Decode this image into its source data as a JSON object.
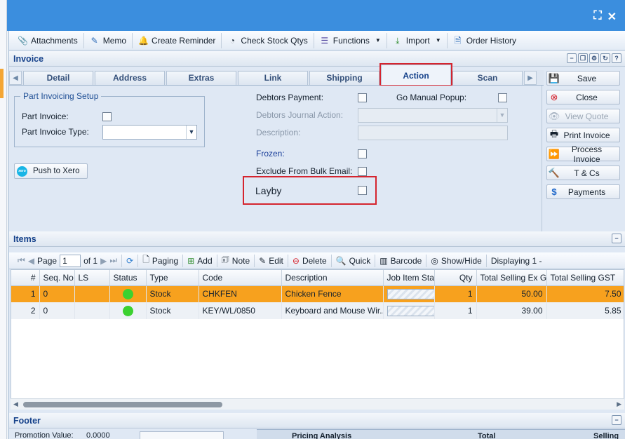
{
  "toolbar": {
    "attachments": "Attachments",
    "memo": "Memo",
    "create_reminder": "Create Reminder",
    "check_stock": "Check Stock Qtys",
    "functions": "Functions",
    "import": "Import",
    "order_history": "Order History"
  },
  "invoice_panel": {
    "title": "Invoice"
  },
  "tabs": [
    "Detail",
    "Address",
    "Extras",
    "Link",
    "Shipping",
    "Action",
    "Scan"
  ],
  "active_tab": "Action",
  "form": {
    "part_invoicing_legend": "Part Invoicing Setup",
    "part_invoice_label": "Part Invoice:",
    "part_invoice_type_label": "Part Invoice Type:",
    "part_invoice_type_value": "",
    "push_to_xero": "Push to Xero",
    "xero_logo": "xero",
    "debtors_payment_label": "Debtors Payment:",
    "go_manual_popup_label": "Go Manual Popup:",
    "debtors_journal_action_label": "Debtors Journal Action:",
    "description_label": "Description:",
    "frozen_label": "Frozen:",
    "exclude_bulk_email_label": "Exclude From Bulk Email:",
    "layby_label": "Layby"
  },
  "side_buttons": {
    "save": "Save",
    "close": "Close",
    "view_quote": "View Quote",
    "print_invoice": "Print Invoice",
    "process_invoice": "Process Invoice",
    "tcs": "T & Cs",
    "payments": "Payments"
  },
  "items_panel": {
    "title": "Items"
  },
  "grid_toolbar": {
    "page_label": "Page",
    "page_value": "1",
    "of_label": "of 1",
    "paging": "Paging",
    "add": "Add",
    "note": "Note",
    "edit": "Edit",
    "delete": "Delete",
    "quick": "Quick",
    "barcode": "Barcode",
    "show_hide": "Show/Hide",
    "displaying": "Displaying 1 -"
  },
  "grid": {
    "columns": [
      "#",
      "Seq. No.",
      "LS",
      "Status",
      "Type",
      "Code",
      "Description",
      "Job Item Stat",
      "Qty",
      "Total Selling Ex GST",
      "Total Selling GST"
    ],
    "rows": [
      {
        "num": "1",
        "seq": "0",
        "ls": "",
        "type": "Stock",
        "code": "CHKFEN",
        "description": "Chicken Fence",
        "qty": "1",
        "ex_gst": "50.00",
        "gst": "7.50"
      },
      {
        "num": "2",
        "seq": "0",
        "ls": "",
        "type": "Stock",
        "code": "KEY/WL/0850",
        "description": "Keyboard and Mouse Wir...",
        "qty": "1",
        "ex_gst": "39.00",
        "gst": "5.85"
      }
    ]
  },
  "footer_panel": {
    "title": "Footer",
    "promotion_label": "Promotion Value:",
    "promotion_value": "0.0000",
    "pricing_analysis": "Pricing Analysis",
    "total": "Total",
    "selling": "Selling"
  },
  "colors": {
    "titlebar": "#3b8ede",
    "selected_row": "#f7a11e",
    "highlight": "#d5242e",
    "status_ok": "#3cd130"
  }
}
